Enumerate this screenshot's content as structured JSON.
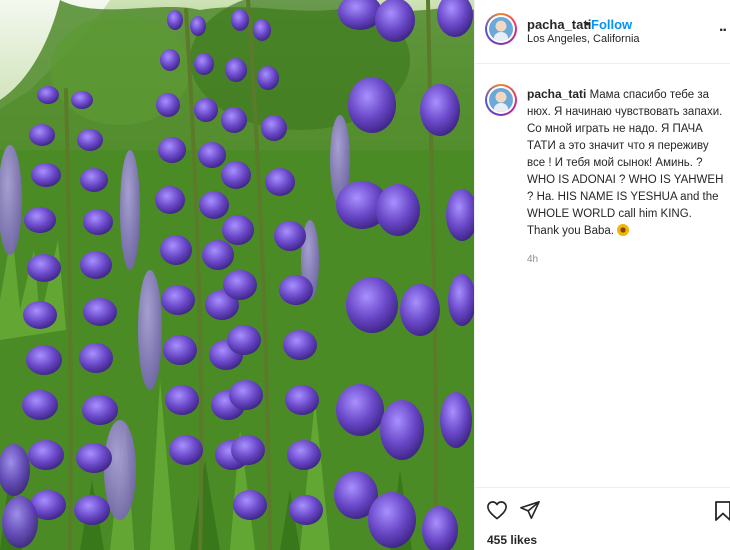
{
  "post": {
    "username": "pacha_tati",
    "separator": "•",
    "follow_label": "Follow",
    "location": "Los Angeles, California",
    "more_label": "..",
    "photo_description": "purple-lupine-flowers-photo"
  },
  "caption": {
    "username": "pacha_tati",
    "text": "Мама спасибо тебе за нюх. Я начинаю чувствовать запахи. Со мной играть не надо. Я ПАЧА ТАТИ а это значит что я переживу все ! И тебя мой сынок! Аминь. ? WHO IS ADONAI ? WHO IS YAHWEH ? Ha. HIS NAME IS YESHUA and the WHOLE WORLD call him KING. Thank you Baba.",
    "emoji": "sunflower-emoji",
    "time": "4h"
  },
  "actions": {
    "like_icon": "heart-icon",
    "share_icon": "share-icon",
    "save_icon": "bookmark-icon",
    "likes_text": "455 likes"
  },
  "colors": {
    "follow": "#0095f6",
    "text": "#262626",
    "muted": "#8e8e8e",
    "border": "#efefef"
  }
}
